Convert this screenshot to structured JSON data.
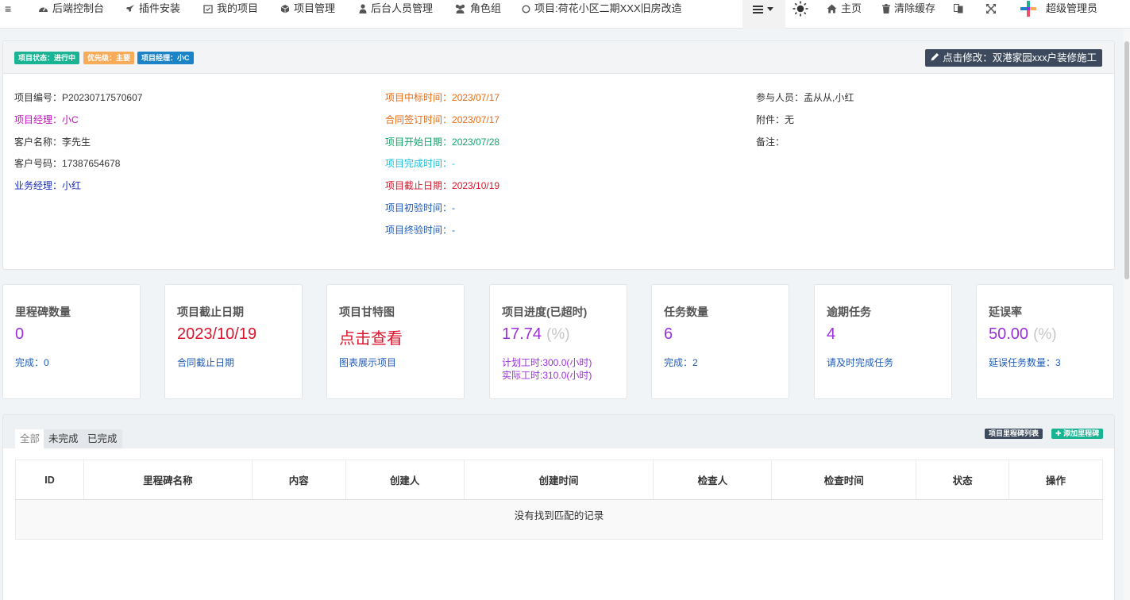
{
  "nav": {
    "items": [
      {
        "label": "后端控制台",
        "icon": "dashboard-icon"
      },
      {
        "label": "插件安装",
        "icon": "rocket-icon"
      },
      {
        "label": "我的项目",
        "icon": "calendar-check-icon"
      },
      {
        "label": "项目管理",
        "icon": "cube-icon"
      },
      {
        "label": "后台人员管理",
        "icon": "user-icon"
      },
      {
        "label": "角色组",
        "icon": "users-icon"
      },
      {
        "label": "项目:荷花小区二期XXX旧房改造",
        "icon": "circle-icon"
      }
    ],
    "right": {
      "home_label": "主页",
      "clear_cache_label": "清除缓存",
      "user_label": "超级管理员"
    }
  },
  "info": {
    "badges": [
      {
        "label": "项目状态：进行中",
        "color": "#1ab394"
      },
      {
        "label": "优先级：主要",
        "color": "#f8ac59"
      },
      {
        "label": "项目经理：小C",
        "color": "#1c84c6"
      }
    ],
    "edit_button": "点击修改：双港家园xxx户装修施工",
    "col1": [
      {
        "label": "项目编号：",
        "value": "P20230717570607",
        "color": "#333333"
      },
      {
        "label": "项目经理：",
        "value": "小C",
        "color": "#c012c0"
      },
      {
        "label": "客户名称：",
        "value": "李先生",
        "color": "#333333"
      },
      {
        "label": "客户号码：",
        "value": "17387654678",
        "color": "#333333"
      },
      {
        "label": "业务经理：",
        "value": "小红",
        "color": "#1b2fbf"
      }
    ],
    "col2": [
      {
        "label": "项目中标时间：",
        "value": "2023/07/17",
        "color": "#e76c16"
      },
      {
        "label": "合同签订时间：",
        "value": "2023/07/17",
        "color": "#e76c16"
      },
      {
        "label": "项目开始日期：",
        "value": "2023/07/28",
        "color": "#14a36a"
      },
      {
        "label": "项目完成时间：",
        "value": "-",
        "color": "#1cc2dc"
      },
      {
        "label": "项目截止日期：",
        "value": "2023/10/19",
        "color": "#d9162c"
      },
      {
        "label": "项目初验时间：",
        "value": "-",
        "color": "#1e5bb8"
      },
      {
        "label": "项目终验时间：",
        "value": "-",
        "color": "#1e5bb8"
      }
    ],
    "col3": [
      {
        "label": "参与人员：",
        "value": "孟从从,小红",
        "color": "#333333"
      },
      {
        "label": "附件：",
        "value": "无",
        "color": "#333333"
      },
      {
        "label": "备注：",
        "value": "",
        "color": "#333333"
      }
    ]
  },
  "cards": [
    {
      "title": "里程碑数量",
      "value": "0",
      "unit": "",
      "value_color": "#9b30d9",
      "sub": [
        "完成：0"
      ]
    },
    {
      "title": "项目截止日期",
      "value": "2023/10/19",
      "unit": "",
      "value_color": "#d9162c",
      "sub": [
        "合同截止日期"
      ]
    },
    {
      "title": "项目甘特图",
      "value": "点击查看",
      "unit": "",
      "value_color": "#d9162c",
      "sub": [
        "图表展示项目"
      ]
    },
    {
      "title": "项目进度(已超时)",
      "value": "17.74",
      "unit": "(%)",
      "value_color": "#9b30d9",
      "sub": [
        "计划工时:300.0(小时)",
        "实际工时:310.0(小时)"
      ],
      "sub_color": "#9b30d9"
    },
    {
      "title": "任务数量",
      "value": "6",
      "unit": "",
      "value_color": "#9b30d9",
      "sub": [
        "完成：2"
      ]
    },
    {
      "title": "逾期任务",
      "value": "4",
      "unit": "",
      "value_color": "#9b30d9",
      "sub": [
        "请及时完成任务"
      ]
    },
    {
      "title": "延误率",
      "value": "50.00",
      "unit": "(%)",
      "value_color": "#9b30d9",
      "sub": [
        "延误任务数量：3"
      ]
    }
  ],
  "milestones": {
    "tabs": [
      "全部",
      "未完成",
      "已完成"
    ],
    "list_button": "项目里程碑列表",
    "add_button": "添加里程碑",
    "columns": [
      "ID",
      "里程碑名称",
      "内容",
      "创建人",
      "创建时间",
      "检查人",
      "检查时间",
      "状态",
      "操作"
    ],
    "empty_text": "没有找到匹配的记录"
  },
  "colors": {
    "edit_button_bg": "#3d4a5d",
    "list_button_bg": "#3d4a5d",
    "add_button_bg": "#1ab394",
    "link_blue": "#1e5bb8"
  }
}
